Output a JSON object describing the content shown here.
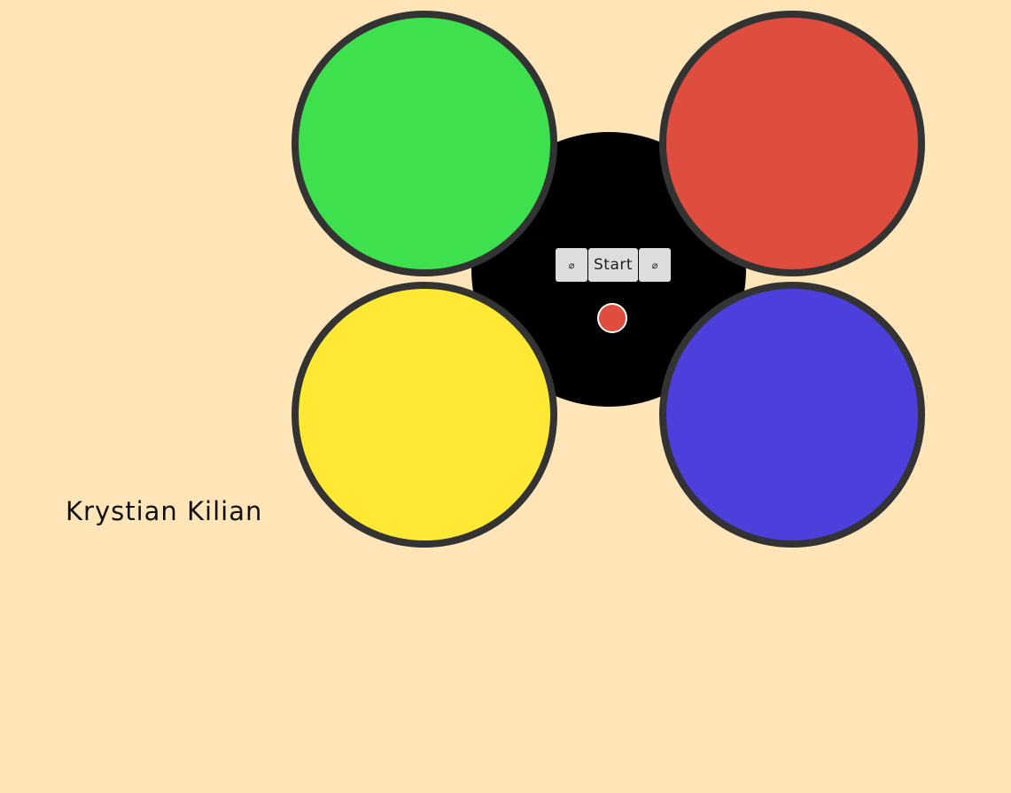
{
  "game": {
    "pads": [
      {
        "name": "green",
        "color": "#3fe04e"
      },
      {
        "name": "red",
        "color": "#de4d3e"
      },
      {
        "name": "yellow",
        "color": "#ffe935"
      },
      {
        "name": "blue",
        "color": "#4c3fdc"
      }
    ],
    "controls": {
      "left_symbol": "⌀",
      "start_label": "Start",
      "right_symbol": "⌀"
    },
    "status_led_color": "#de4d3e"
  },
  "author": {
    "name": "Krystian Kilian"
  }
}
